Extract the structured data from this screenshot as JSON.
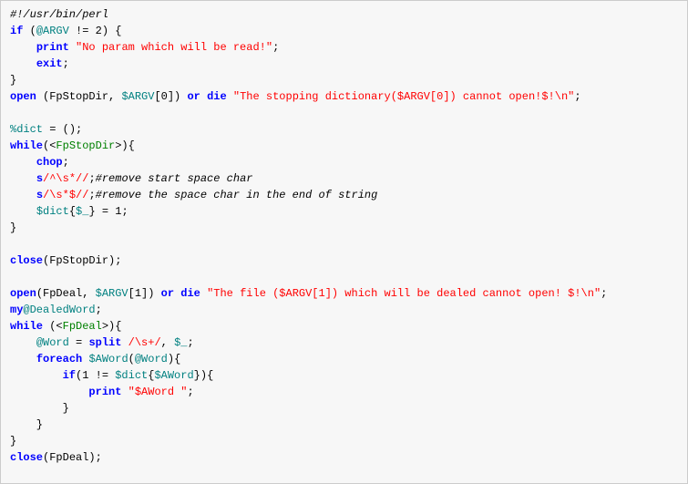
{
  "code": {
    "lines": [
      [
        {
          "cls": "tok-comment-black",
          "text": "#!/usr/bin/perl"
        }
      ],
      [
        {
          "cls": "tok-blue",
          "text": "if"
        },
        {
          "cls": "tok-black",
          "text": " ("
        },
        {
          "cls": "tok-teal",
          "text": "@ARGV"
        },
        {
          "cls": "tok-black",
          "text": " != 2) {"
        }
      ],
      [
        {
          "cls": "tok-black",
          "text": "    "
        },
        {
          "cls": "tok-blue",
          "text": "print"
        },
        {
          "cls": "tok-black",
          "text": " "
        },
        {
          "cls": "tok-red",
          "text": "\"No param which will be read!\""
        },
        {
          "cls": "tok-black",
          "text": ";"
        }
      ],
      [
        {
          "cls": "tok-black",
          "text": "    "
        },
        {
          "cls": "tok-blue",
          "text": "exit"
        },
        {
          "cls": "tok-black",
          "text": ";"
        }
      ],
      [
        {
          "cls": "tok-black",
          "text": "}"
        }
      ],
      [
        {
          "cls": "tok-blue",
          "text": "open"
        },
        {
          "cls": "tok-black",
          "text": " (FpStopDir, "
        },
        {
          "cls": "tok-teal",
          "text": "$ARGV"
        },
        {
          "cls": "tok-black",
          "text": "[0]) "
        },
        {
          "cls": "tok-blue",
          "text": "or"
        },
        {
          "cls": "tok-black",
          "text": " "
        },
        {
          "cls": "tok-blue",
          "text": "die"
        },
        {
          "cls": "tok-black",
          "text": " "
        },
        {
          "cls": "tok-red",
          "text": "\"The stopping dictionary($ARGV[0]) cannot open!$!\\n\""
        },
        {
          "cls": "tok-black",
          "text": ";"
        }
      ],
      [
        {
          "cls": "tok-black",
          "text": ""
        }
      ],
      [
        {
          "cls": "tok-teal",
          "text": "%dict"
        },
        {
          "cls": "tok-black",
          "text": " = ();"
        }
      ],
      [
        {
          "cls": "tok-blue",
          "text": "while"
        },
        {
          "cls": "tok-black",
          "text": "(<"
        },
        {
          "cls": "tok-green",
          "text": "FpStopDir"
        },
        {
          "cls": "tok-black",
          "text": ">){"
        }
      ],
      [
        {
          "cls": "tok-black",
          "text": "    "
        },
        {
          "cls": "tok-blue",
          "text": "chop"
        },
        {
          "cls": "tok-black",
          "text": ";"
        }
      ],
      [
        {
          "cls": "tok-black",
          "text": "    "
        },
        {
          "cls": "tok-blue",
          "text": "s"
        },
        {
          "cls": "tok-red",
          "text": "/^\\s*//"
        },
        {
          "cls": "tok-black",
          "text": ";"
        },
        {
          "cls": "tok-comment-black",
          "text": "#remove start space char"
        }
      ],
      [
        {
          "cls": "tok-black",
          "text": "    "
        },
        {
          "cls": "tok-blue",
          "text": "s"
        },
        {
          "cls": "tok-red",
          "text": "/\\s*$//"
        },
        {
          "cls": "tok-black",
          "text": ";"
        },
        {
          "cls": "tok-comment-black",
          "text": "#remove the space char in the end of string"
        }
      ],
      [
        {
          "cls": "tok-black",
          "text": "    "
        },
        {
          "cls": "tok-teal",
          "text": "$dict"
        },
        {
          "cls": "tok-black",
          "text": "{"
        },
        {
          "cls": "tok-teal",
          "text": "$_"
        },
        {
          "cls": "tok-black",
          "text": "} = 1;"
        }
      ],
      [
        {
          "cls": "tok-black",
          "text": "}"
        }
      ],
      [
        {
          "cls": "tok-black",
          "text": ""
        }
      ],
      [
        {
          "cls": "tok-blue",
          "text": "close"
        },
        {
          "cls": "tok-black",
          "text": "(FpStopDir);"
        }
      ],
      [
        {
          "cls": "tok-black",
          "text": ""
        }
      ],
      [
        {
          "cls": "tok-blue",
          "text": "open"
        },
        {
          "cls": "tok-black",
          "text": "(FpDeal, "
        },
        {
          "cls": "tok-teal",
          "text": "$ARGV"
        },
        {
          "cls": "tok-black",
          "text": "[1]) "
        },
        {
          "cls": "tok-blue",
          "text": "or"
        },
        {
          "cls": "tok-black",
          "text": " "
        },
        {
          "cls": "tok-blue",
          "text": "die"
        },
        {
          "cls": "tok-black",
          "text": " "
        },
        {
          "cls": "tok-red",
          "text": "\"The file ($ARGV[1]) which will be dealed cannot open! $!\\n\""
        },
        {
          "cls": "tok-black",
          "text": ";"
        }
      ],
      [
        {
          "cls": "tok-blue",
          "text": "my"
        },
        {
          "cls": "tok-teal",
          "text": "@DealedWord"
        },
        {
          "cls": "tok-black",
          "text": ";"
        }
      ],
      [
        {
          "cls": "tok-blue",
          "text": "while"
        },
        {
          "cls": "tok-black",
          "text": " (<"
        },
        {
          "cls": "tok-green",
          "text": "FpDeal"
        },
        {
          "cls": "tok-black",
          "text": ">){"
        }
      ],
      [
        {
          "cls": "tok-black",
          "text": "    "
        },
        {
          "cls": "tok-teal",
          "text": "@Word"
        },
        {
          "cls": "tok-black",
          "text": " = "
        },
        {
          "cls": "tok-blue",
          "text": "split"
        },
        {
          "cls": "tok-black",
          "text": " "
        },
        {
          "cls": "tok-red",
          "text": "/\\s+/"
        },
        {
          "cls": "tok-black",
          "text": ", "
        },
        {
          "cls": "tok-teal",
          "text": "$_"
        },
        {
          "cls": "tok-black",
          "text": ";"
        }
      ],
      [
        {
          "cls": "tok-black",
          "text": "    "
        },
        {
          "cls": "tok-blue",
          "text": "foreach"
        },
        {
          "cls": "tok-black",
          "text": " "
        },
        {
          "cls": "tok-teal",
          "text": "$AWord"
        },
        {
          "cls": "tok-black",
          "text": "("
        },
        {
          "cls": "tok-teal",
          "text": "@Word"
        },
        {
          "cls": "tok-black",
          "text": "){"
        }
      ],
      [
        {
          "cls": "tok-black",
          "text": "        "
        },
        {
          "cls": "tok-blue",
          "text": "if"
        },
        {
          "cls": "tok-black",
          "text": "(1 != "
        },
        {
          "cls": "tok-teal",
          "text": "$dict"
        },
        {
          "cls": "tok-black",
          "text": "{"
        },
        {
          "cls": "tok-teal",
          "text": "$AWord"
        },
        {
          "cls": "tok-black",
          "text": "}){"
        }
      ],
      [
        {
          "cls": "tok-black",
          "text": "            "
        },
        {
          "cls": "tok-blue",
          "text": "print"
        },
        {
          "cls": "tok-black",
          "text": " "
        },
        {
          "cls": "tok-red",
          "text": "\"$AWord \""
        },
        {
          "cls": "tok-black",
          "text": ";"
        }
      ],
      [
        {
          "cls": "tok-black",
          "text": "        }"
        }
      ],
      [
        {
          "cls": "tok-black",
          "text": "    }"
        }
      ],
      [
        {
          "cls": "tok-black",
          "text": "}"
        }
      ],
      [
        {
          "cls": "tok-blue",
          "text": "close"
        },
        {
          "cls": "tok-black",
          "text": "(FpDeal);"
        }
      ]
    ]
  }
}
